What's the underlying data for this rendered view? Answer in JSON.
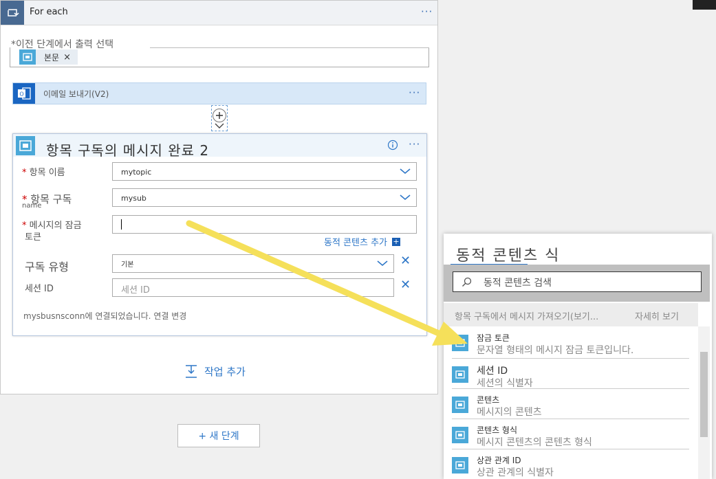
{
  "foreach": {
    "title": "For each",
    "prev_label": "*이전 단계에서 출력 선택",
    "token": "본문"
  },
  "send_email": {
    "title": "이메일 보내기(V2)"
  },
  "card": {
    "title": "항목 구독의 메시지 완료 2",
    "topic_label": "항목 이름",
    "topic_value": "mytopic",
    "sub_label": "항목 구독",
    "sub_sub": "name",
    "sub_value": "mysub",
    "lock_label_1": "메시지의 잠금",
    "lock_label_2": "토큰",
    "lock_value": "",
    "add_dynamic": "동적 콘텐츠 추가",
    "sub_type_label": "구독 유형",
    "sub_type_value": "기본",
    "session_label": "세션 ID",
    "session_placeholder": "세션 ID",
    "connection_text": "mysbusnsconn에 연결되었습니다.",
    "change_connection": "연결 변경"
  },
  "add_action": "작업 추가",
  "new_step": "+ 새 단계",
  "dynamic_panel": {
    "title": "동적 콘텐츠 식",
    "search_placeholder": "동적 콘텐츠 검색",
    "section": "항목 구독에서 메시지 가져오기(보기...",
    "see_more": "자세히 보기",
    "items": [
      {
        "name": "잠금 토큰",
        "desc": "문자열 형태의 메시지 잠금 토큰입니다."
      },
      {
        "name": "세션 ID",
        "desc": "세션의 식별자"
      },
      {
        "name": "콘텐츠",
        "desc": "메시지의 콘텐츠"
      },
      {
        "name": "콘텐츠 형식",
        "desc": "메시지 콘텐츠의 콘텐츠 형식"
      },
      {
        "name": "상관 관계 ID",
        "desc": "상관 관계의 식별자"
      }
    ]
  },
  "colors": {
    "accent": "#2d76c7",
    "token_blue": "#4aa8d8",
    "arrow": "#f5e05a"
  }
}
